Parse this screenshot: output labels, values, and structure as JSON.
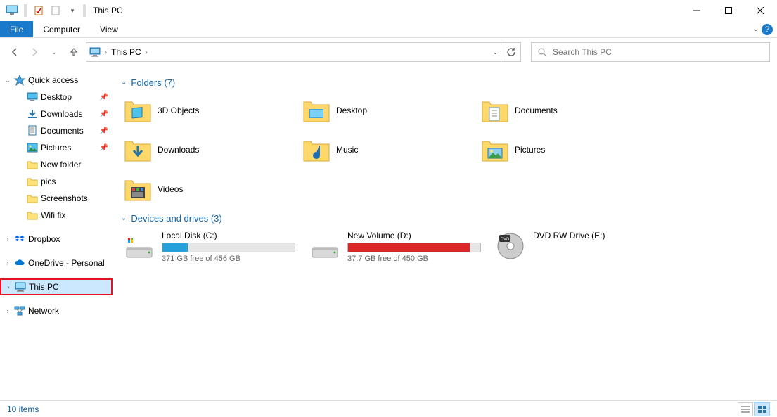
{
  "window": {
    "title": "This PC"
  },
  "menubar": {
    "file": "File",
    "computer": "Computer",
    "view": "View"
  },
  "breadcrumb": {
    "location": "This PC"
  },
  "search": {
    "placeholder": "Search This PC"
  },
  "sidebar": {
    "quick_access": "Quick access",
    "quick_items": [
      {
        "label": "Desktop",
        "pinned": true
      },
      {
        "label": "Downloads",
        "pinned": true
      },
      {
        "label": "Documents",
        "pinned": true
      },
      {
        "label": "Pictures",
        "pinned": true
      },
      {
        "label": "New folder",
        "pinned": false
      },
      {
        "label": "pics",
        "pinned": false
      },
      {
        "label": "Screenshots",
        "pinned": false
      },
      {
        "label": "Wifi fix",
        "pinned": false
      }
    ],
    "dropbox": "Dropbox",
    "onedrive": "OneDrive - Personal",
    "this_pc": "This PC",
    "network": "Network"
  },
  "groups": {
    "folders_header": "Folders (7)",
    "folders": [
      {
        "label": "3D Objects"
      },
      {
        "label": "Desktop"
      },
      {
        "label": "Documents"
      },
      {
        "label": "Downloads"
      },
      {
        "label": "Music"
      },
      {
        "label": "Pictures"
      },
      {
        "label": "Videos"
      }
    ],
    "drives_header": "Devices and drives (3)",
    "drives": [
      {
        "label": "Local Disk (C:)",
        "free_text": "371 GB free of 456 GB",
        "fill_pct": 19,
        "fill_color": "#26a0da"
      },
      {
        "label": "New Volume (D:)",
        "free_text": "37.7 GB free of 450 GB",
        "fill_pct": 92,
        "fill_color": "#da2626"
      },
      {
        "label": "DVD RW Drive (E:)",
        "free_text": "",
        "fill_pct": 0,
        "fill_color": ""
      }
    ]
  },
  "statusbar": {
    "items": "10 items"
  }
}
